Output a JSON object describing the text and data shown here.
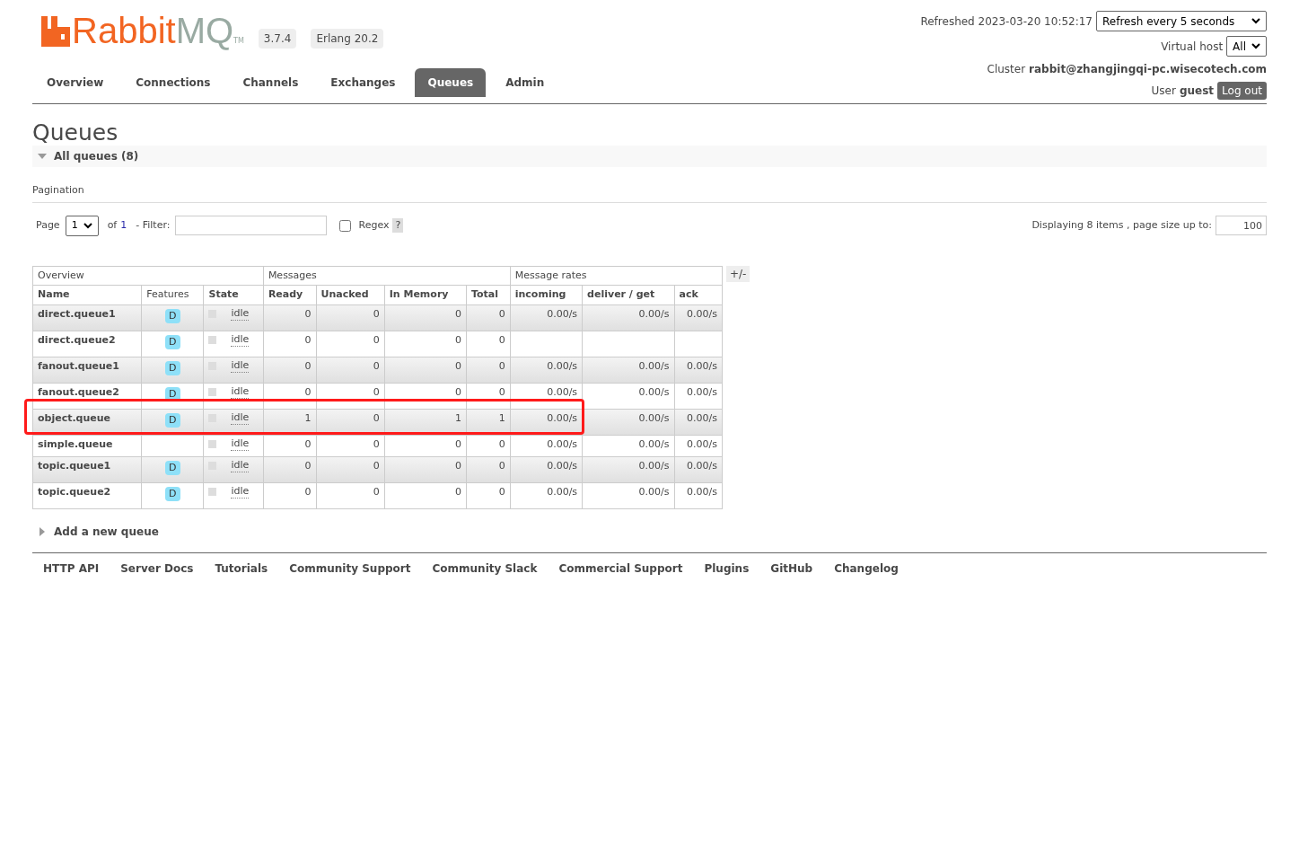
{
  "header": {
    "logo": {
      "part_1": "Rabbit",
      "part_2": "MQ",
      "trademark": "TM"
    },
    "version": "3.7.4",
    "erlang": "Erlang 20.2",
    "refreshed": "Refreshed 2023-03-20 10:52:17",
    "refresh_select": "Refresh every 5 seconds",
    "vhost_label": "Virtual host",
    "vhost_select": "All",
    "cluster_label": "Cluster",
    "cluster_name": "rabbit@zhangjingqi-pc.wisecotech.com",
    "user_label": "User",
    "user_name": "guest",
    "logout": "Log out"
  },
  "tabs": [
    {
      "label": "Overview",
      "selected": false
    },
    {
      "label": "Connections",
      "selected": false
    },
    {
      "label": "Channels",
      "selected": false
    },
    {
      "label": "Exchanges",
      "selected": false
    },
    {
      "label": "Queues",
      "selected": true
    },
    {
      "label": "Admin",
      "selected": false
    }
  ],
  "page_title": "Queues",
  "section": {
    "title": "All queues (8)",
    "expanded": true
  },
  "pagination": {
    "title": "Pagination",
    "page_label": "Page",
    "page_select": "1",
    "of_label": "of",
    "of_value": "1",
    "filter_label": "- Filter:",
    "regex_label": "Regex",
    "regex_checked": false,
    "help": "?",
    "displaying": "Displaying 8 items , page size up to:",
    "page_size": "100"
  },
  "table": {
    "groups": [
      "Overview",
      "Messages",
      "Message rates"
    ],
    "toggle": "+/-",
    "columns": [
      "Name",
      "Features",
      "State",
      "Ready",
      "Unacked",
      "In Memory",
      "Total",
      "incoming",
      "deliver / get",
      "ack"
    ],
    "rows": [
      {
        "name": "direct.queue1",
        "features": [
          "D"
        ],
        "state": "idle",
        "ready": "0",
        "unacked": "0",
        "in_memory": "0",
        "total": "0",
        "incoming": "0.00/s",
        "deliver_get": "0.00/s",
        "ack": "0.00/s",
        "highlighted": false
      },
      {
        "name": "direct.queue2",
        "features": [
          "D"
        ],
        "state": "idle",
        "ready": "0",
        "unacked": "0",
        "in_memory": "0",
        "total": "0",
        "highlighted": false
      },
      {
        "name": "fanout.queue1",
        "features": [
          "D"
        ],
        "state": "idle",
        "ready": "0",
        "unacked": "0",
        "in_memory": "0",
        "total": "0",
        "incoming": "0.00/s",
        "deliver_get": "0.00/s",
        "ack": "0.00/s",
        "highlighted": false
      },
      {
        "name": "fanout.queue2",
        "features": [
          "D"
        ],
        "state": "idle",
        "ready": "0",
        "unacked": "0",
        "in_memory": "0",
        "total": "0",
        "incoming": "0.00/s",
        "deliver_get": "0.00/s",
        "ack": "0.00/s",
        "highlighted": false
      },
      {
        "name": "object.queue",
        "features": [
          "D"
        ],
        "state": "idle",
        "ready": "1",
        "unacked": "0",
        "in_memory": "1",
        "total": "1",
        "incoming": "0.00/s",
        "deliver_get": "0.00/s",
        "ack": "0.00/s",
        "highlighted": true
      },
      {
        "name": "simple.queue",
        "state": "idle",
        "ready": "0",
        "unacked": "0",
        "in_memory": "0",
        "total": "0",
        "incoming": "0.00/s",
        "deliver_get": "0.00/s",
        "ack": "0.00/s",
        "highlighted": false
      },
      {
        "name": "topic.queue1",
        "features": [
          "D"
        ],
        "state": "idle",
        "ready": "0",
        "unacked": "0",
        "in_memory": "0",
        "total": "0",
        "incoming": "0.00/s",
        "deliver_get": "0.00/s",
        "ack": "0.00/s",
        "highlighted": false
      },
      {
        "name": "topic.queue2",
        "features": [
          "D"
        ],
        "state": "idle",
        "ready": "0",
        "unacked": "0",
        "in_memory": "0",
        "total": "0",
        "incoming": "0.00/s",
        "deliver_get": "0.00/s",
        "ack": "0.00/s",
        "highlighted": false
      }
    ]
  },
  "add_section": {
    "title": "Add a new queue",
    "expanded": false
  },
  "footer_links": [
    "HTTP API",
    "Server Docs",
    "Tutorials",
    "Community Support",
    "Community Slack",
    "Commercial Support",
    "Plugins",
    "GitHub",
    "Changelog"
  ]
}
